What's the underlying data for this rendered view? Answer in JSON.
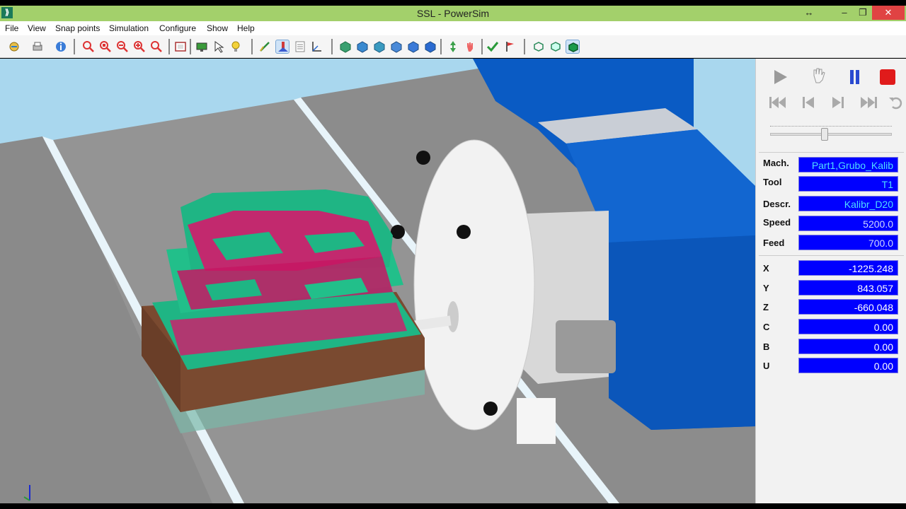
{
  "window": {
    "title": "SSL - PowerSim",
    "controls": {
      "restore_glyph": "↔",
      "minimize_glyph": "–",
      "maximize_glyph": "❐",
      "close_glyph": "✕"
    },
    "app_icon_glyph": "⟫"
  },
  "menu": {
    "items": [
      "File",
      "View",
      "Snap points",
      "Simulation",
      "Configure",
      "Show",
      "Help"
    ]
  },
  "toolbar": {
    "icons": [
      "open-icon",
      "print-icon",
      "info-icon",
      "zoom-in-red-icon",
      "zoom-box-icon",
      "zoom-out-icon",
      "zoom-all-icon",
      "zoom-fit-icon",
      "frame-icon",
      "screen-icon",
      "cursor-icon",
      "bulb-icon",
      "toolpath-icon",
      "machine-icon",
      "table-icon",
      "axes-icon",
      "view-iso-icon",
      "view-front-icon",
      "view-side-icon",
      "view-right-icon",
      "view-top-icon",
      "move-icon",
      "hand-icon",
      "check-icon",
      "flag-icon",
      "stock-wire-icon",
      "stock-outline-icon",
      "stock-solid-icon"
    ],
    "selected_index": 13,
    "colors": {
      "accent": "#2a8c5a",
      "danger": "#d63a3a"
    }
  },
  "simulation": {
    "controls": [
      "play-icon",
      "hand-icon",
      "pause-icon",
      "stop-icon",
      "rewind-start-icon",
      "step-back-icon",
      "step-forward-icon",
      "forward-end-icon",
      "undo-icon"
    ],
    "speed_level": 0.45
  },
  "properties": {
    "machine": {
      "label": "Mach.",
      "value": "Part1,Grubo_Kalib"
    },
    "tool": {
      "label": "Tool",
      "value": "T1"
    },
    "description": {
      "label": "Descr.",
      "value": "Kalibr_D20"
    },
    "speed": {
      "label": "Speed",
      "value": "5200.0"
    },
    "feed": {
      "label": "Feed",
      "value": "700.0"
    }
  },
  "coordinates": {
    "x": {
      "label": "X",
      "value": "-1225.248"
    },
    "y": {
      "label": "Y",
      "value": "843.057"
    },
    "z": {
      "label": "Z",
      "value": "-660.048"
    },
    "c": {
      "label": "C",
      "value": "0.00"
    },
    "b": {
      "label": "B",
      "value": "0.00"
    },
    "u": {
      "label": "U",
      "value": "0.00"
    }
  },
  "colors": {
    "field_bg": "#0000ff",
    "title_bar": "#a3d06b",
    "machine_blue": "#0a5bc4",
    "stock_green": "#1fb584",
    "stock_magenta": "#d4196b",
    "wood_base": "#7a4a30"
  }
}
